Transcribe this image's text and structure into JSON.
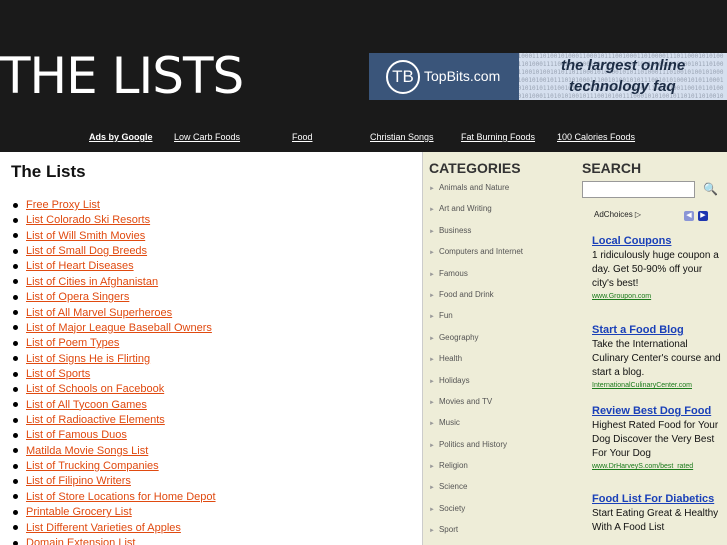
{
  "header": {
    "site_title": "THE LISTS",
    "banner": {
      "logo": "TB",
      "brand": "TopBits.com",
      "tagline_line1": "the largest online",
      "tagline_line2": "technology faq",
      "binary_text": "010001110100101000110001011100100011010000111011000101010011101000111100101010010101000110001011100111101001011101001110010100101011011000101000010101101000111010010100101000110010100101110101000111001010010101110010101000101011000110101010110100101110101100101001010001110101001100101101000010100011010101001011100101001110001010100101101011010010111010100101101000101010100101"
    }
  },
  "nav": {
    "ads_label": "Ads by Google",
    "links": [
      "Low Carb Foods",
      "Food",
      "Christian Songs",
      "Fat Burning Foods",
      "100 Calories Foods"
    ]
  },
  "main": {
    "heading": "The Lists",
    "items": [
      "Free Proxy List",
      "List Colorado Ski Resorts",
      "List of Will Smith Movies",
      "List of Small Dog Breeds",
      "List of Heart Diseases",
      "List of Cities in Afghanistan",
      "List of Opera Singers",
      "List of All Marvel Superheroes",
      "List of Major League Baseball Owners",
      "List of Poem Types",
      "List of Signs He is Flirting",
      "List of Sports",
      "List of Schools on Facebook",
      "List of All Tycoon Games",
      "List of Radioactive Elements",
      "List of Famous Duos",
      "Matilda Movie Songs List",
      "List of Trucking Companies",
      "List of Filipino Writers",
      "List of Store Locations for Home Depot",
      "Printable Grocery List",
      "List Different Varieties of Apples",
      "Domain Extension List"
    ]
  },
  "categories": {
    "heading": "CATEGORIES",
    "items": [
      "Animals and Nature",
      "Art and Writing",
      "Business",
      "Computers and Internet",
      "Famous",
      "Food and Drink",
      "Fun",
      "Geography",
      "Health",
      "Holidays",
      "Movies and TV",
      "Music",
      "Politics and History",
      "Religion",
      "Science",
      "Society",
      "Sport"
    ]
  },
  "sidebar": {
    "search_heading": "SEARCH",
    "search_value": "",
    "adchoices_label": "AdChoices",
    "adchoices_glyph": "▷",
    "prev_glyph": "◀",
    "next_glyph": "▶",
    "search_glyph": "🔍",
    "ads": [
      {
        "title": "Local Coupons",
        "body": "1 ridiculously huge coupon a day. Get 50-90% off your city's best!",
        "url": "www.Groupon.com"
      },
      {
        "title": "Start a Food Blog",
        "body": "Take the International Culinary Center's course and start a blog.",
        "url": "InternationalCulinaryCenter.com"
      },
      {
        "title": "Review Best Dog Food",
        "body": "Highest Rated Food for Your Dog Discover the Very Best For Your Dog",
        "url": "www.DrHarveyS.com/best_rated"
      },
      {
        "title": "Food List For Diabetics",
        "body": "Start Eating Great & Healthy With A Food List",
        "url": ""
      }
    ]
  }
}
